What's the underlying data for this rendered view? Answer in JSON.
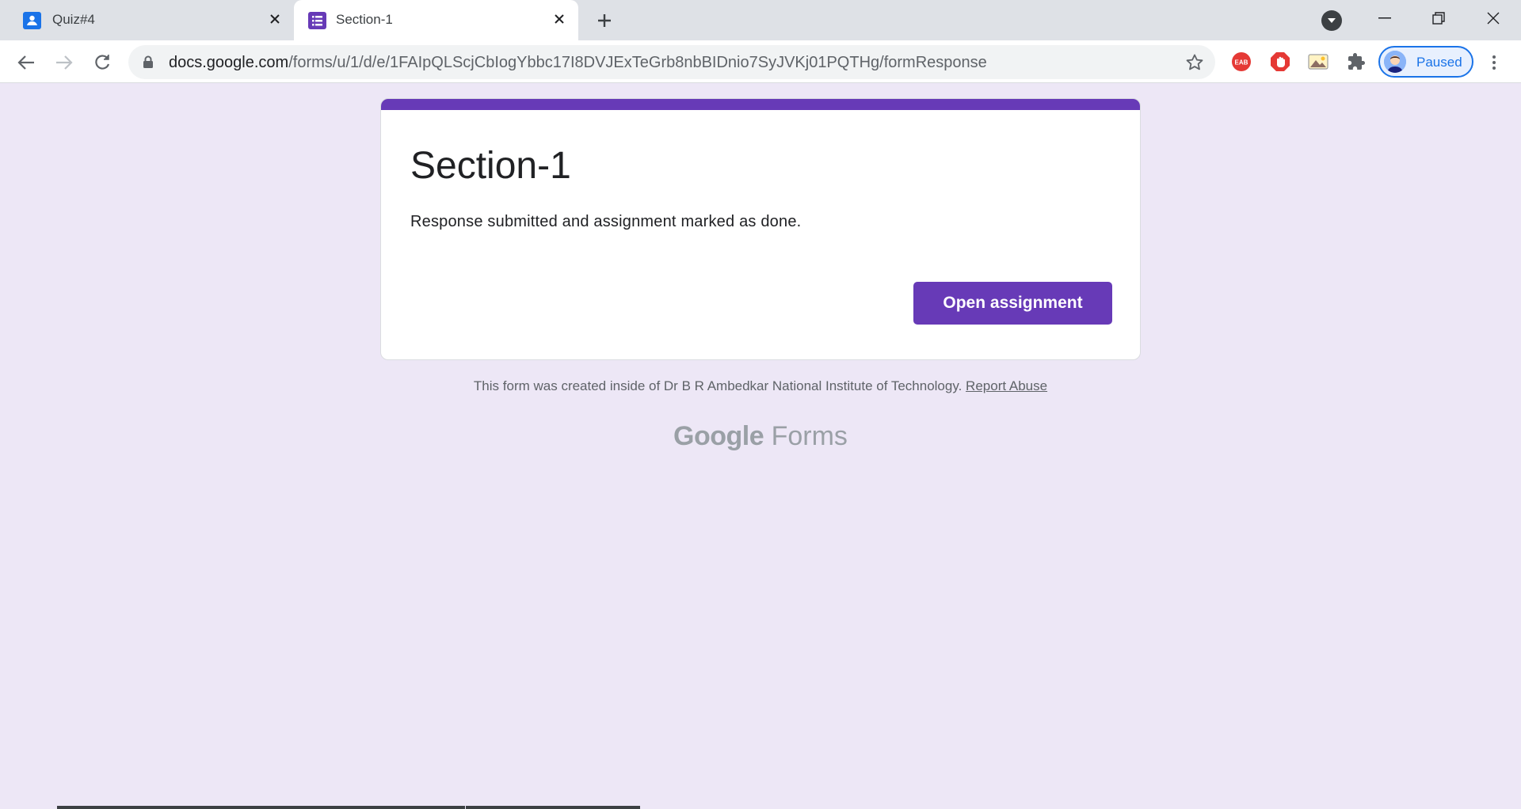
{
  "browser": {
    "tabs": [
      {
        "title": "Quiz#4",
        "active": false
      },
      {
        "title": "Section-1",
        "active": true
      }
    ],
    "url_host": "docs.google.com",
    "url_path": "/forms/u/1/d/e/1FAIpQLScjCbIogYbbc17I8DVJExTeGrb8nbBIDnio7SyJVKj01PQTHg/formResponse",
    "profile_label": "Paused",
    "extensions": [
      "eab-icon",
      "adblock-icon",
      "image-icon",
      "puzzle-icon"
    ]
  },
  "form": {
    "title": "Section-1",
    "message": "Response submitted and assignment marked as done.",
    "button_label": "Open assignment",
    "accent_color": "#673ab7"
  },
  "footer": {
    "text": "This form was created inside of Dr B R Ambedkar National Institute of Technology.",
    "link": "Report Abuse",
    "brand_google": "Google",
    "brand_forms": "Forms"
  }
}
